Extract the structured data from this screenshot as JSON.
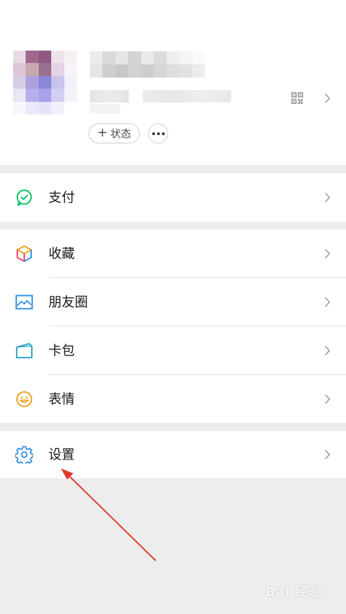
{
  "profile": {
    "status_plus": "+",
    "status_label": "状态"
  },
  "menu": {
    "pay": "支付",
    "favorites": "收藏",
    "moments": "朋友圈",
    "cards": "卡包",
    "stickers": "表情",
    "settings": "设置"
  },
  "colors": {
    "pay_green": "#07c160",
    "settings_blue": "#2f8fe0",
    "annotation_red": "#e03a2f"
  },
  "watermark": "Bai 经验"
}
